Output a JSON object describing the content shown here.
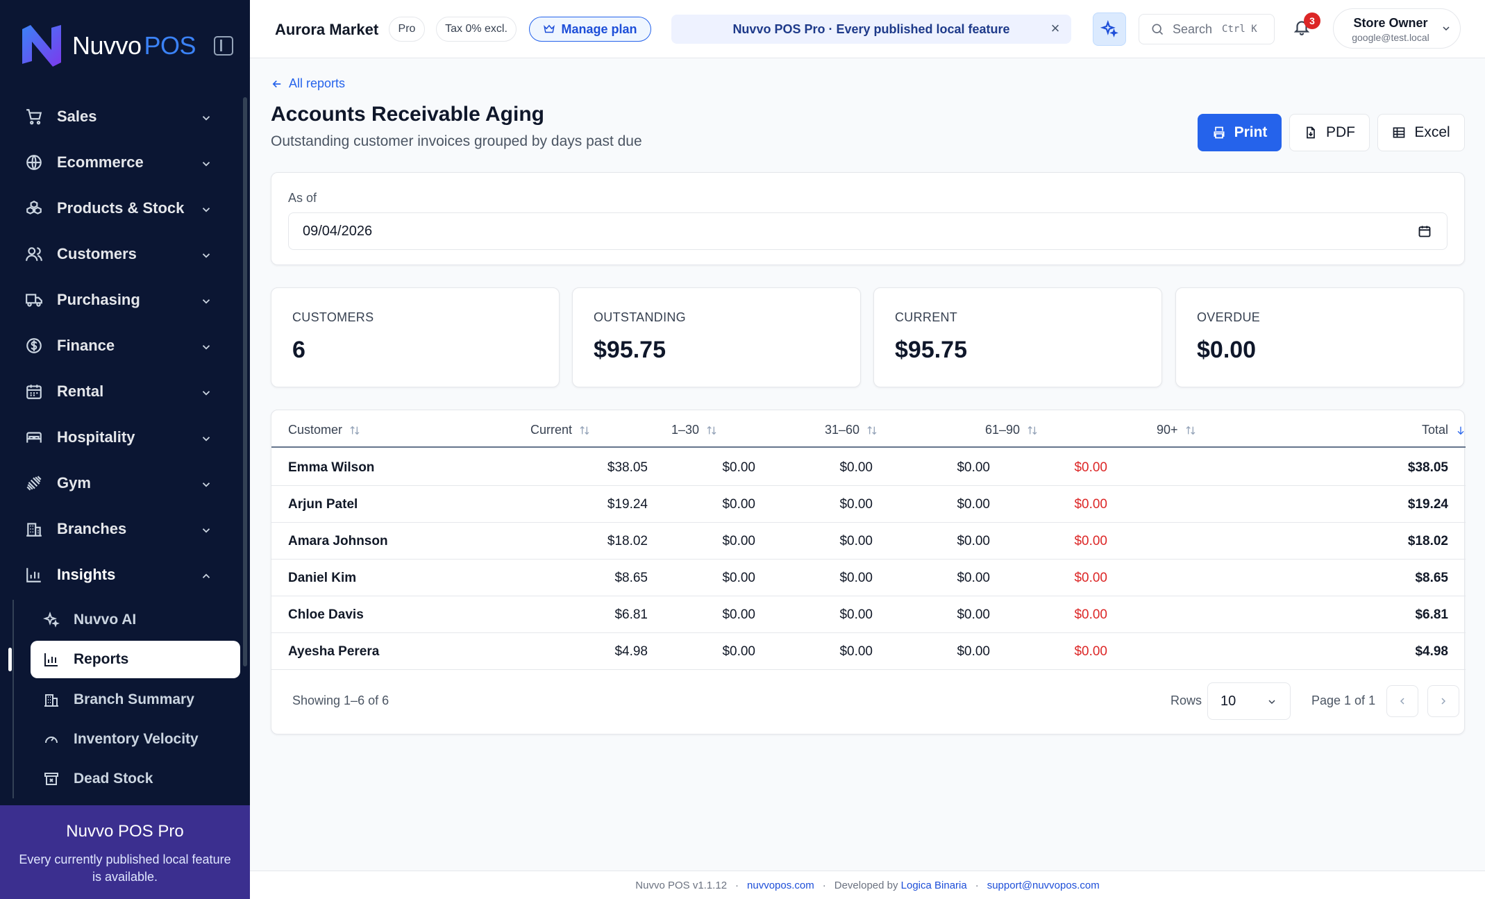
{
  "brand": {
    "name": "Nuvvo",
    "suffix": "POS"
  },
  "sidebar": {
    "items": [
      {
        "label": "Sales",
        "icon": "cart-icon"
      },
      {
        "label": "Ecommerce",
        "icon": "globe-icon"
      },
      {
        "label": "Products & Stock",
        "icon": "boxes-icon"
      },
      {
        "label": "Customers",
        "icon": "users-icon"
      },
      {
        "label": "Purchasing",
        "icon": "truck-icon"
      },
      {
        "label": "Finance",
        "icon": "dollar-icon"
      },
      {
        "label": "Rental",
        "icon": "calendar-icon"
      },
      {
        "label": "Hospitality",
        "icon": "bed-icon"
      },
      {
        "label": "Gym",
        "icon": "dumbbell-icon"
      },
      {
        "label": "Branches",
        "icon": "building-icon"
      },
      {
        "label": "Insights",
        "icon": "bar-chart-icon"
      }
    ],
    "insights_sub": [
      {
        "label": "Nuvvo AI",
        "icon": "sparkles-icon"
      },
      {
        "label": "Reports",
        "icon": "bar-chart-icon"
      },
      {
        "label": "Branch Summary",
        "icon": "building-icon"
      },
      {
        "label": "Inventory Velocity",
        "icon": "gauge-icon"
      },
      {
        "label": "Dead Stock",
        "icon": "archive-x-icon"
      }
    ],
    "promo": {
      "title": "Nuvvo POS Pro",
      "desc": "Every currently published local feature is available."
    }
  },
  "header": {
    "store": "Aurora Market",
    "plan_chip": "Pro",
    "tax_chip": "Tax 0% excl.",
    "manage_plan": "Manage plan",
    "banner": "Nuvvo POS Pro · Every published local feature",
    "banner_close": "×",
    "search_placeholder": "Search",
    "search_kbd": "Ctrl K",
    "notifications": "3",
    "user_name": "Store Owner",
    "user_email": "google@test.local"
  },
  "page": {
    "back": "All reports",
    "title": "Accounts Receivable Aging",
    "subtitle": "Outstanding customer invoices grouped by days past due",
    "print": "Print",
    "pdf": "PDF",
    "excel": "Excel",
    "as_of_label": "As of",
    "as_of_value": "09/04/2026"
  },
  "kpis": [
    {
      "label": "CUSTOMERS",
      "value": "6"
    },
    {
      "label": "OUTSTANDING",
      "value": "$95.75"
    },
    {
      "label": "CURRENT",
      "value": "$95.75"
    },
    {
      "label": "OVERDUE",
      "value": "$0.00"
    }
  ],
  "table": {
    "columns": [
      "Customer",
      "Current",
      "1–30",
      "31–60",
      "61–90",
      "90+",
      "Total"
    ],
    "rows": [
      [
        "Emma Wilson",
        "$38.05",
        "$0.00",
        "$0.00",
        "$0.00",
        "$0.00",
        "$38.05"
      ],
      [
        "Arjun Patel",
        "$19.24",
        "$0.00",
        "$0.00",
        "$0.00",
        "$0.00",
        "$19.24"
      ],
      [
        "Amara Johnson",
        "$18.02",
        "$0.00",
        "$0.00",
        "$0.00",
        "$0.00",
        "$18.02"
      ],
      [
        "Daniel Kim",
        "$8.65",
        "$0.00",
        "$0.00",
        "$0.00",
        "$0.00",
        "$8.65"
      ],
      [
        "Chloe Davis",
        "$6.81",
        "$0.00",
        "$0.00",
        "$0.00",
        "$0.00",
        "$6.81"
      ],
      [
        "Ayesha Perera",
        "$4.98",
        "$0.00",
        "$0.00",
        "$0.00",
        "$0.00",
        "$4.98"
      ]
    ],
    "showing": "Showing 1–6 of 6",
    "rows_label": "Rows",
    "rows_value": "10",
    "page_label": "Page 1 of 1"
  },
  "footer": {
    "version": "Nuvvo POS v1.1.12",
    "site": "nuvvopos.com",
    "dev_prefix": "Developed by",
    "dev": "Logica Binaria",
    "email": "support@nuvvopos.com"
  },
  "colors": {
    "sidebar": "#0b1633",
    "accent": "#2563eb",
    "danger": "#dc2626",
    "promo": "#3b2f8f"
  }
}
